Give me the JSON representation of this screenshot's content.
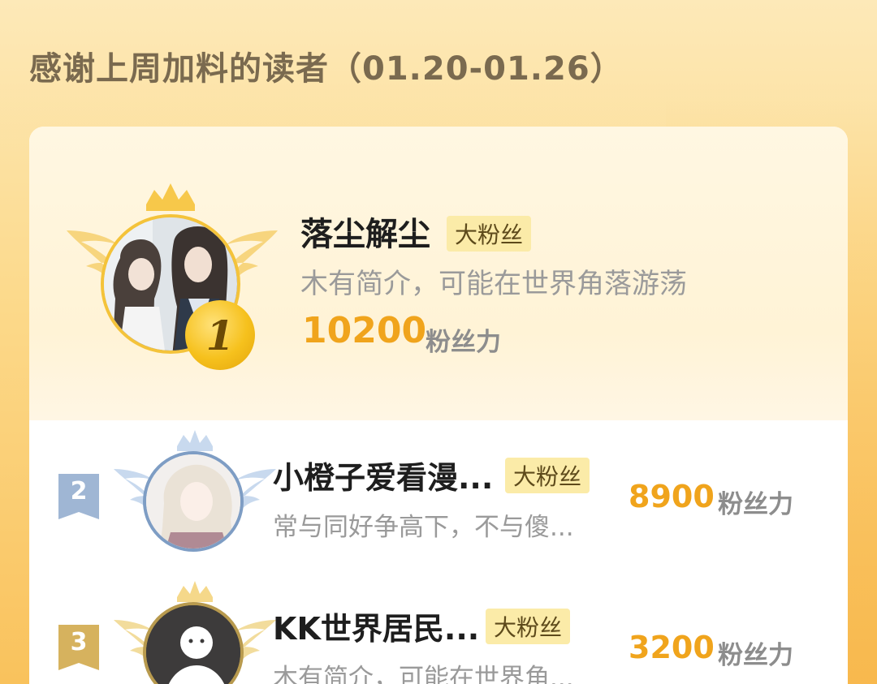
{
  "title": "感谢上周加料的读者（01.20-01.26）",
  "badge_label": "大粉丝",
  "score_unit": "粉丝力",
  "top_reader": {
    "rank": "1",
    "name": "落尘解尘",
    "bio": "木有简介，可能在世界角落游荡",
    "score": "10200"
  },
  "readers": [
    {
      "rank": "2",
      "name": "小橙子爱看漫...",
      "bio": "常与同好争高下，不与傻...",
      "score": "8900"
    },
    {
      "rank": "3",
      "name": "KK世界居民...",
      "bio": "木有简介，可能在世界角...",
      "score": "3200"
    }
  ],
  "colors": {
    "gold": "#f0a41c",
    "silver_rank": "#9fb6d4",
    "bronze_rank": "#d6b25e"
  }
}
